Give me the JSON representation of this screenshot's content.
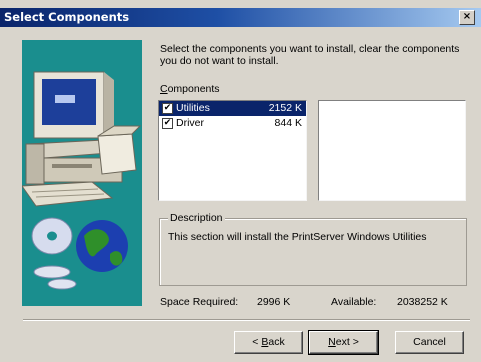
{
  "window": {
    "title": "Select Components",
    "close_glyph": "×"
  },
  "intro_text": "Select the components you want to install, clear the components you do not want to install.",
  "components": {
    "label_mnemonic": "C",
    "label_rest": "omponents",
    "items": [
      {
        "name": "Utilities",
        "size": "2152 K",
        "checked": true,
        "selected": true
      },
      {
        "name": "Driver",
        "size": "844 K",
        "checked": true,
        "selected": false
      }
    ]
  },
  "description": {
    "title": "Description",
    "text": "This section will install the PrintServer Windows Utilities"
  },
  "space": {
    "required_label": "Space Required:",
    "required_value": "2996 K",
    "available_label": "Available:",
    "available_value": "2038252 K"
  },
  "buttons": {
    "back_prefix": "< ",
    "back_mnemonic": "B",
    "back_rest": "ack",
    "next_mnemonic": "N",
    "next_rest": "ext >",
    "cancel": "Cancel"
  },
  "colors": {
    "title_gradient_start": "#0a246a",
    "title_gradient_end": "#a6caf0",
    "art_background": "#1a8e8e",
    "selection": "#0a246a"
  },
  "icons": {
    "art": "computer-and-globe-illustration",
    "checkbox": "check-mark"
  }
}
